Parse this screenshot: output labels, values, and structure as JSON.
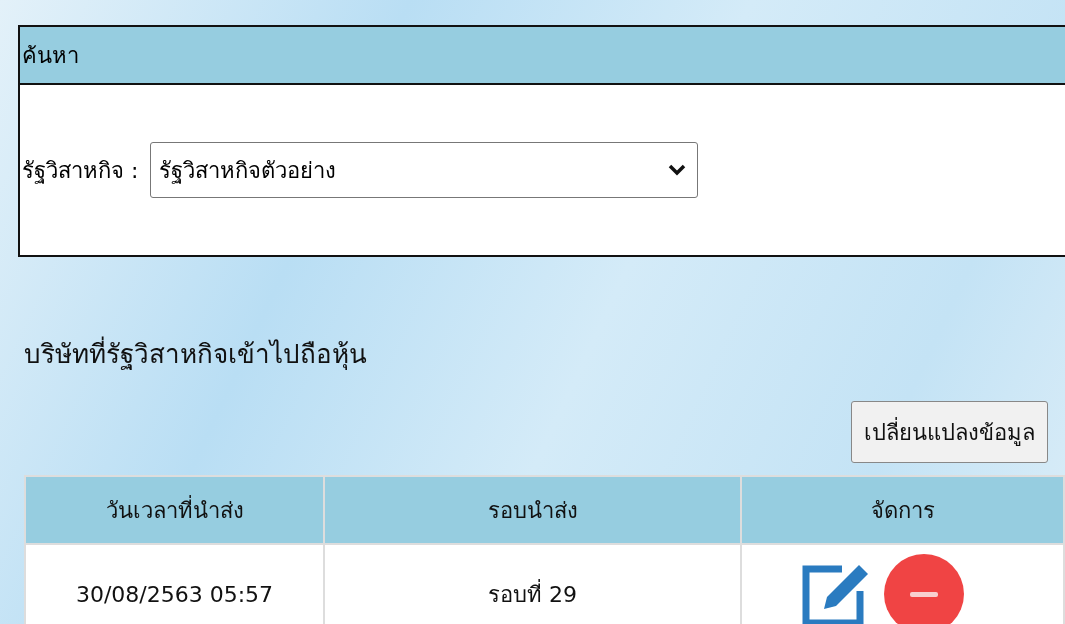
{
  "search_panel": {
    "title": "ค้นหา",
    "field_label": "รัฐวิสาหกิจ :",
    "select_value": "รัฐวิสาหกิจตัวอย่าง"
  },
  "section": {
    "title": "บริษัทที่รัฐวิสาหกิจเข้าไปถือหุ้น",
    "edit_button": "เปลี่ยนแปลงข้อมูล"
  },
  "table": {
    "columns": [
      "วันเวลาที่นำส่ง",
      "รอบนำส่ง",
      "จัดการ"
    ],
    "rows": [
      {
        "submitted_at": "30/08/2563 05:57",
        "round": "รอบที่ 29",
        "actions": [
          {
            "kind": "edit"
          },
          {
            "kind": "delete"
          }
        ]
      }
    ]
  }
}
